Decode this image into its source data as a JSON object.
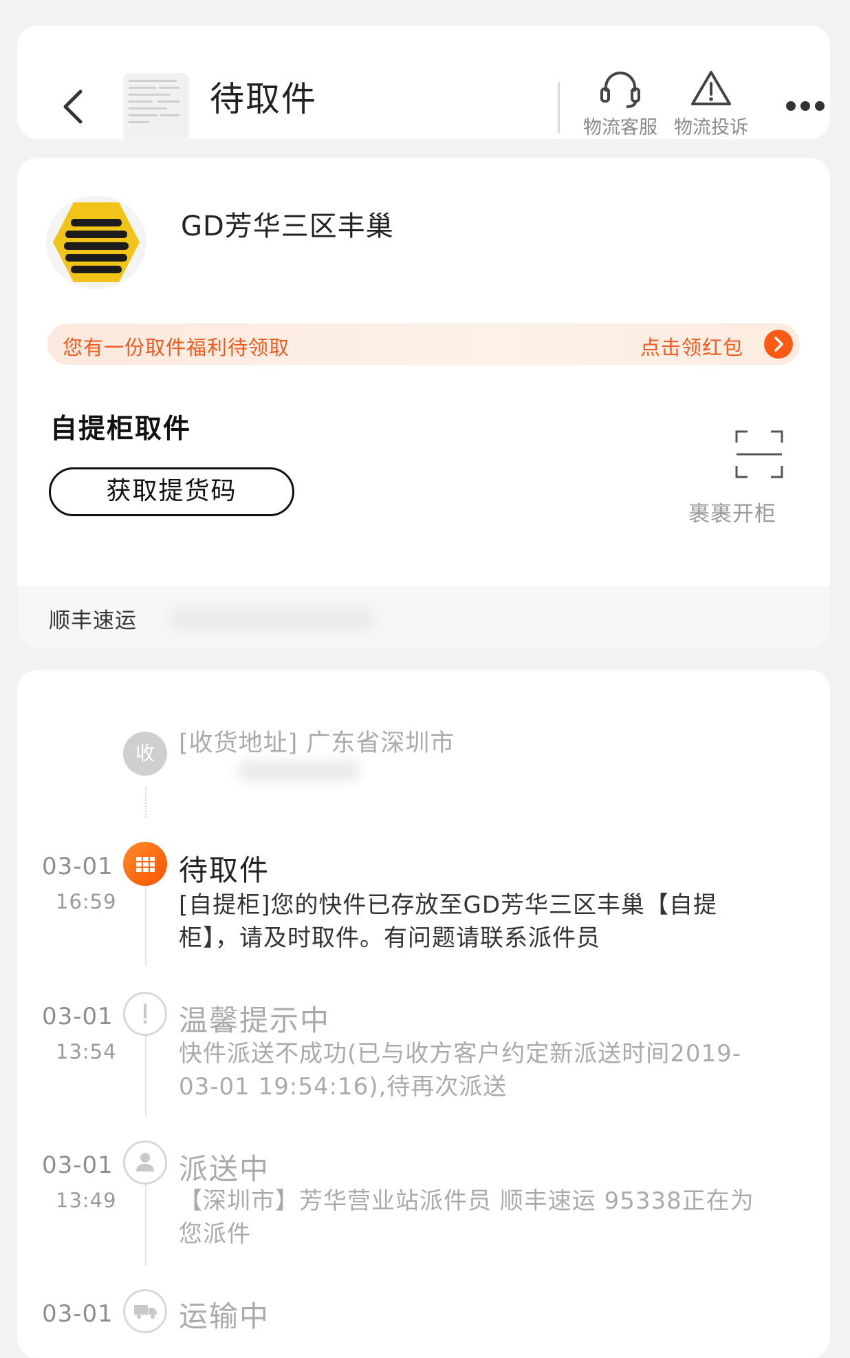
{
  "header": {
    "title": "待取件",
    "service_label": "物流客服",
    "complaint_label": "物流投诉"
  },
  "station": {
    "name": "GD芳华三区丰巢",
    "promo_text": "您有一份取件福利待领取",
    "promo_action": "点击领红包",
    "pickup_label": "自提柜取件",
    "code_button": "获取提货码",
    "scan_label": "裹裹开柜",
    "courier": "顺丰速运"
  },
  "timeline": {
    "address_label": "[收货地址] 广东省深圳市",
    "receive_node": "收",
    "events": [
      {
        "date": "03-01",
        "time": "16:59",
        "status": "待取件",
        "desc": "[自提柜]您的快件已存放至GD芳华三区丰巢【自提柜】，请及时取件。有问题请联系派件员"
      },
      {
        "date": "03-01",
        "time": "13:54",
        "status": "温馨提示中",
        "desc": "快件派送不成功(已与收方客户约定新派送时间2019-03-01 19:54:16),待再次派送"
      },
      {
        "date": "03-01",
        "time": "13:49",
        "status": "派送中",
        "desc": "【深圳市】芳华营业站派件员 顺丰速运 95338正在为您派件"
      },
      {
        "date": "03-01",
        "time": "",
        "status": "运输中",
        "desc": ""
      }
    ]
  },
  "colors": {
    "accent": "#ff5a14",
    "promo_text": "#ee5a1f",
    "logo_yellow": "#f2c318"
  },
  "icons": {
    "back": "chevron-left-icon",
    "service": "headset-icon",
    "complaint": "warning-triangle-icon",
    "more": "more-dots-icon",
    "scan": "scan-frame-icon",
    "promo_arrow": "chevron-right-icon",
    "locker": "locker-grid-icon",
    "alert": "exclamation-icon",
    "courier": "person-icon",
    "truck": "truck-icon"
  }
}
